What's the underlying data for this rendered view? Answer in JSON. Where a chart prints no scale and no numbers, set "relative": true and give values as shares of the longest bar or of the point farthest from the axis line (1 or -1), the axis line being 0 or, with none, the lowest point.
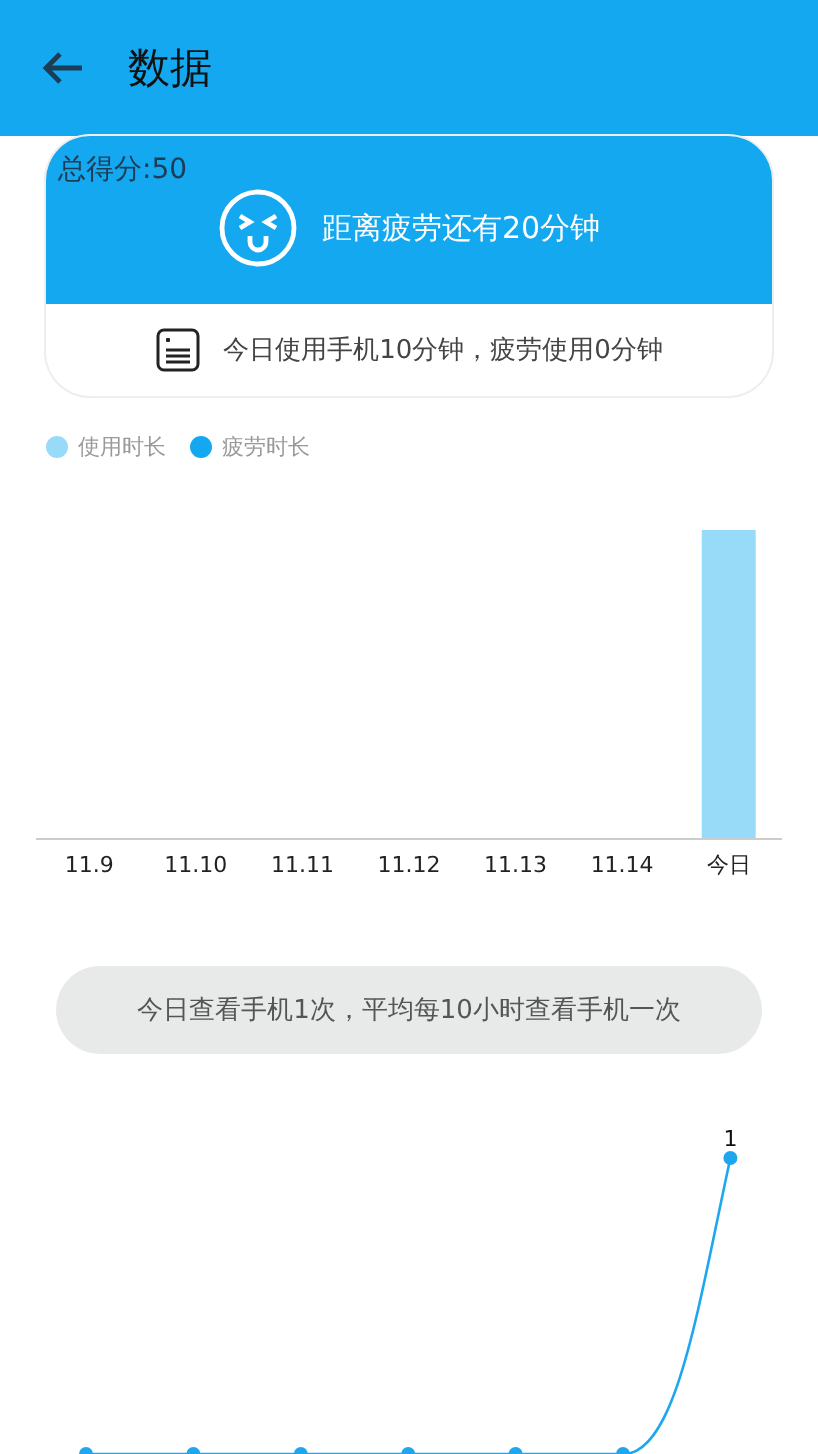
{
  "app_bar": {
    "title": "数据"
  },
  "summary": {
    "score": "总得分:50",
    "countdown": "距离疲劳还有20分钟",
    "usage": "今日使用手机10分钟，疲劳使用0分钟"
  },
  "usage_chart": {
    "chart_data": {
      "type": "bar",
      "relative": true,
      "categories": [
        "11.9",
        "11.10",
        "11.11",
        "11.12",
        "11.13",
        "11.14",
        "今日"
      ],
      "series": [
        {
          "name": "使用时长",
          "color": "#97dbf8",
          "values": [
            0,
            0,
            0,
            0,
            0,
            0,
            1
          ]
        },
        {
          "name": "疲劳时长",
          "color": "#13a8f0",
          "values": [
            0,
            0,
            0,
            0,
            0,
            0,
            0
          ]
        }
      ]
    }
  },
  "check_note": "今日查看手机1次，平均每10小时查看手机一次",
  "check_chart": {
    "chart_data": {
      "type": "line",
      "relative": true,
      "series": [
        {
          "color": "#1ea7ee",
          "marker": "circle",
          "values": [
            0,
            0,
            0,
            0,
            0,
            0,
            1
          ]
        }
      ],
      "value_labels": [
        null,
        null,
        null,
        null,
        null,
        null,
        "1"
      ]
    }
  }
}
